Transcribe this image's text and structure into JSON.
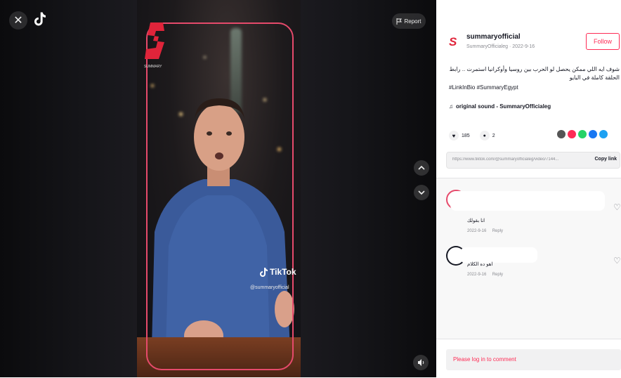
{
  "player": {
    "close_icon": "close-icon",
    "report_label": "Report",
    "watermark_brand": "TikTok",
    "watermark_handle": "@summaryofficial",
    "logo_caption": "SUMMARY"
  },
  "author": {
    "username": "summaryofficial",
    "handle_meta": "SummaryOfficialeg · 2022-9-16",
    "follow_label": "Follow"
  },
  "caption": {
    "text": "شوف ايه اللي ممكن يحصل لو الحرب بين روسيا وأوكرانيا استمرت .. رابط الحلقة كاملة في البايو",
    "tags": "#LinkInBio #SummaryEgypt"
  },
  "sound": {
    "label": "original sound - SummaryOfficialeg"
  },
  "stats": {
    "likes": "185",
    "comments": "2"
  },
  "link": {
    "url": "https://www.tiktok.com/@summaryofficialeg/video/7144...",
    "copy_label": "Copy link"
  },
  "comments": [
    {
      "text": "انا بقولك",
      "meta": "2022-9-16",
      "reply": "Reply"
    },
    {
      "text": "اهو ده الكلام",
      "meta": "2022-9-16",
      "reply": "Reply"
    }
  ],
  "login": {
    "prompt": "Please log in to comment"
  },
  "colors": {
    "accent": "#fe2c55",
    "frame": "#e64a6b"
  }
}
